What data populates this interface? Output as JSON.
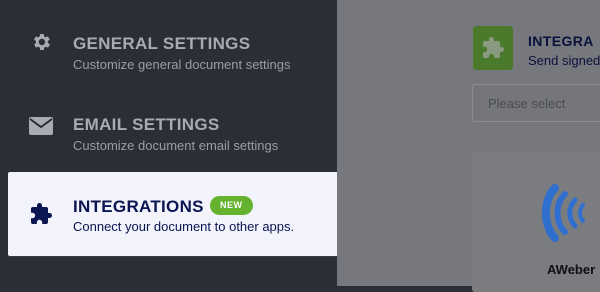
{
  "sidebar": {
    "items": [
      {
        "title": "GENERAL SETTINGS",
        "subtitle": "Customize general document settings",
        "icon": "gear-icon"
      },
      {
        "title": "EMAIL SETTINGS",
        "subtitle": "Customize document email settings",
        "icon": "envelope-icon"
      },
      {
        "title": "INTEGRATIONS",
        "subtitle": "Connect your document to other apps.",
        "icon": "puzzle-icon",
        "badge": "NEW",
        "active": true
      }
    ]
  },
  "panel": {
    "icon": "puzzle-icon",
    "title": "INTEGRA",
    "subtitle": "Send signed",
    "select_placeholder": "Please select",
    "cards": [
      {
        "label": "AWeber",
        "icon": "aweber-logo-icon"
      }
    ]
  },
  "colors": {
    "sidebar_bg": "#2b2e37",
    "active_item_bg": "#f2f3fb",
    "active_text": "#0a1551",
    "badge_bg": "#64b22d",
    "overlay_bg": "#77787e",
    "integration_icon_bg": "#4a7a2b",
    "aweber_blue": "#2f6fd0"
  }
}
